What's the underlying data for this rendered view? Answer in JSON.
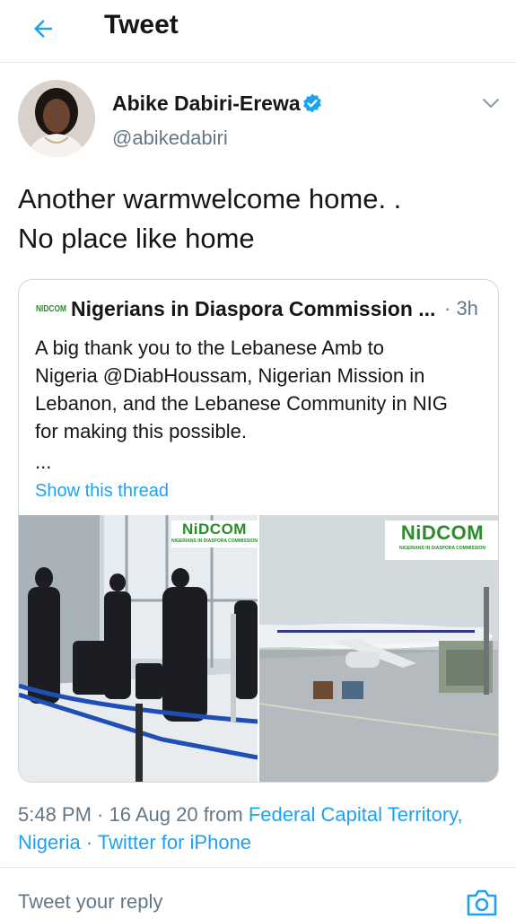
{
  "header": {
    "title": "Tweet"
  },
  "tweet": {
    "author_name": "Abike Dabiri-Erewa",
    "author_handle": "@abikedabiri",
    "text_lines": [
      "Another warmwelcome home. .",
      "No place like home"
    ],
    "timestamp": "5:48 PM · 16 Aug 20 from ",
    "location": "Federal Capital Territory,",
    "location_cont": "Nigeria",
    "separator": " · ",
    "source": "Twitter for iPhone"
  },
  "quoted": {
    "author_name": "Nigerians in Diaspora Commission ...",
    "time": "· 3h",
    "logo_text": "NIDCOM",
    "text_lines": [
      "A big thank you to the Lebanese Amb to",
      "Nigeria @DiabHoussam, Nigerian Mission in",
      "Lebanon, and the Lebanese Community in NIG",
      "for making this possible."
    ],
    "more": "...",
    "show_thread": "Show this thread",
    "watermark_title": "NiDCOM",
    "watermark_sub": "NIGERIANS IN DIASPORA COMMISSION"
  },
  "reply": {
    "placeholder": "Tweet your reply"
  },
  "colors": {
    "accent": "#1da1f2",
    "text": "#14171a",
    "muted": "#657786",
    "border": "#e1e8ed",
    "brand_green": "#2b8a2b"
  },
  "icons": {
    "back": "arrow-left-icon",
    "verified": "verified-badge-icon",
    "caret": "chevron-down-icon",
    "camera": "camera-icon"
  }
}
